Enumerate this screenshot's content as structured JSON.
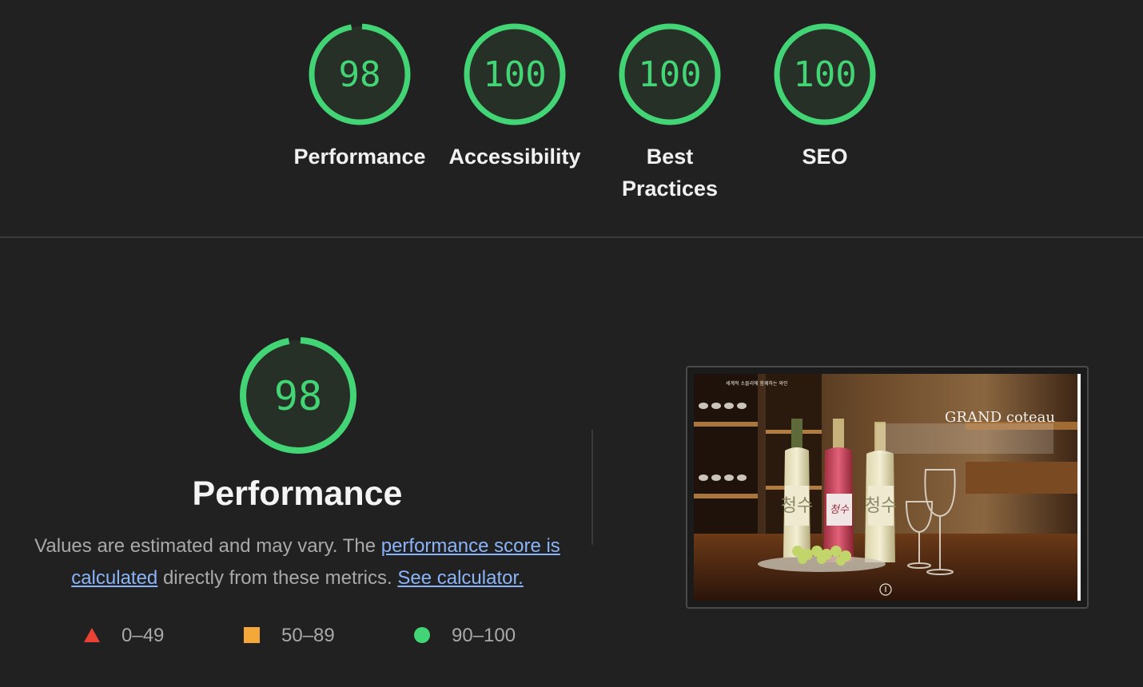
{
  "summary_gauges": [
    {
      "category": "performance",
      "score": "98",
      "label": "Performance",
      "fill": 0.98
    },
    {
      "category": "accessibility",
      "score": "100",
      "label": "Accessibility",
      "fill": 1.0
    },
    {
      "category": "best-practices",
      "score": "100",
      "label": "Best Practices",
      "fill": 1.0
    },
    {
      "category": "seo",
      "score": "100",
      "label": "SEO",
      "fill": 1.0
    }
  ],
  "performance_section": {
    "score": "98",
    "fill": 0.98,
    "title": "Performance",
    "description_pre": "Values are estimated and may vary. The ",
    "link_score": "performance score is calculated",
    "description_mid": " directly from these metrics. ",
    "link_calculator": "See calculator."
  },
  "legend": [
    {
      "shape": "triangle",
      "range": "0–49",
      "color": "#ff4e42"
    },
    {
      "shape": "square",
      "range": "50–89",
      "color": "#ffa400"
    },
    {
      "shape": "circle",
      "range": "90–100",
      "color": "#0cce6b"
    }
  ],
  "screenshot": {
    "brand": "GRAND coteau",
    "nav_text": "세계적 소믈리에  함께하는 와인",
    "bottle_label_1": "청수",
    "bottle_label_2": "청수",
    "bottle_label_3": "청수"
  },
  "colors": {
    "pass": "#43d475",
    "gauge_bg": "#273127",
    "background": "#212121",
    "link": "#8ab4f8"
  }
}
